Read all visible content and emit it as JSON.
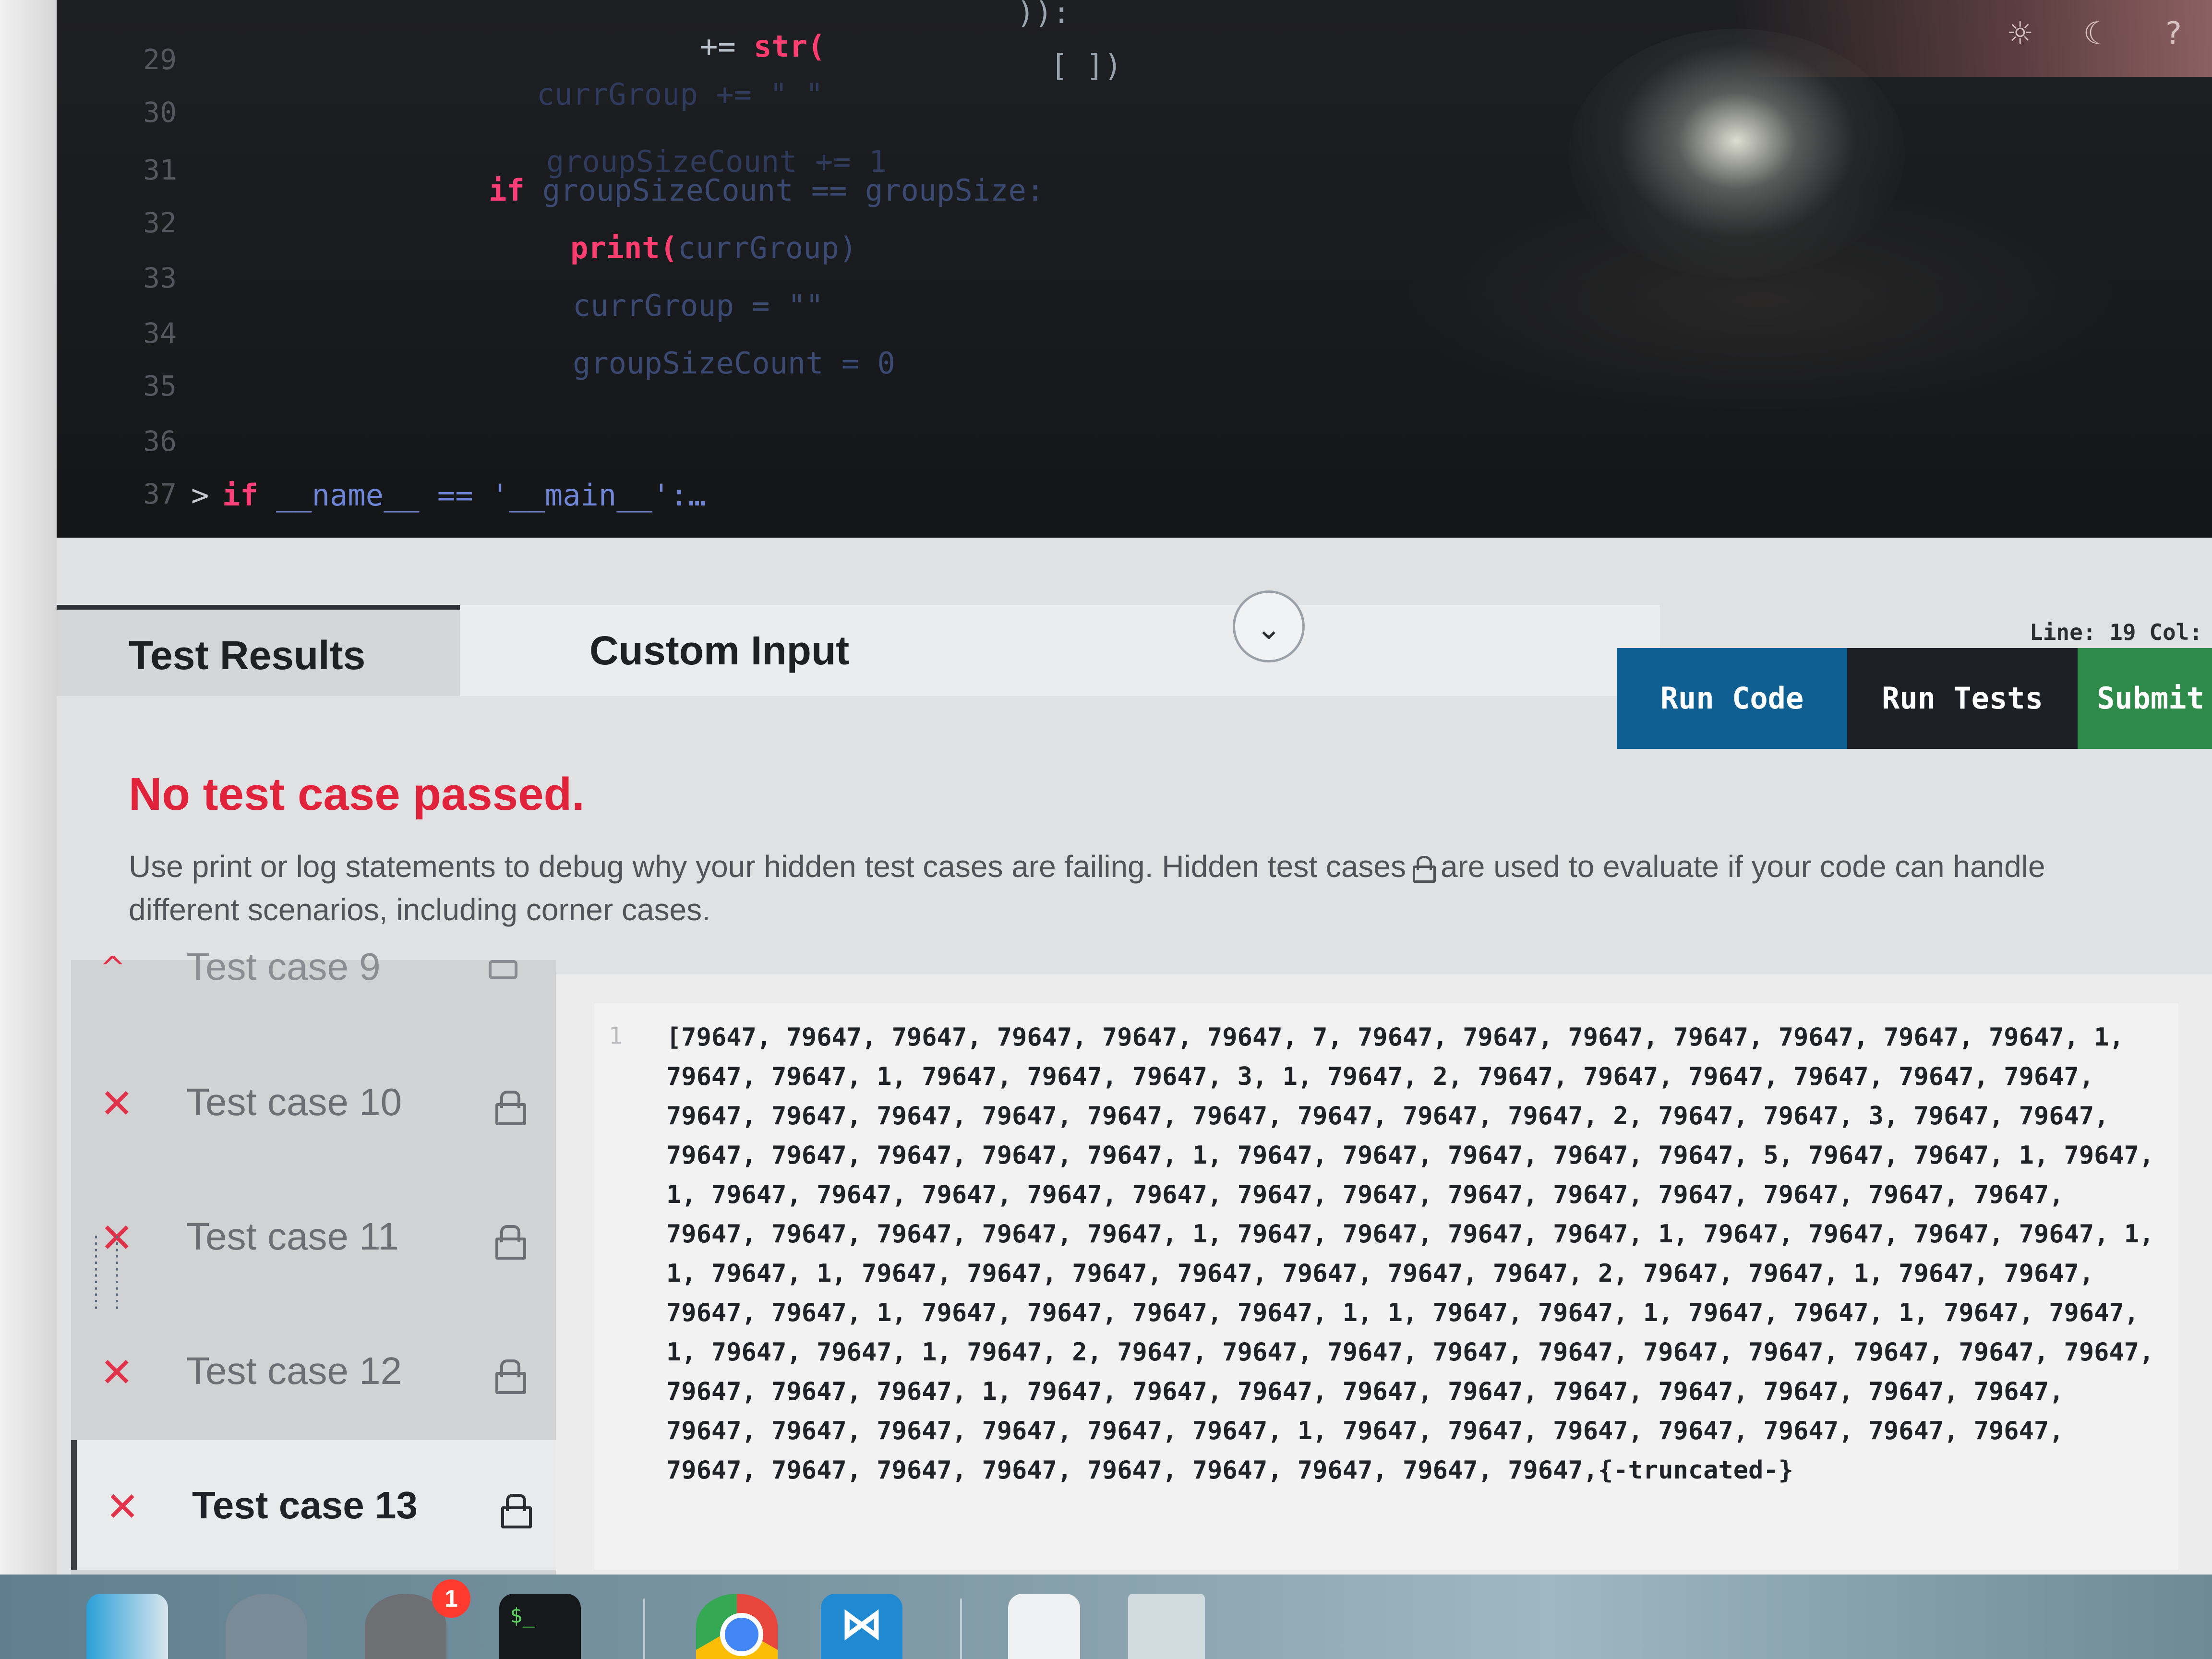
{
  "editor": {
    "lines": [
      {
        "no": "29",
        "code_a": "+= ",
        "code_fn": "str(",
        "code_b": ""
      },
      {
        "no": "30",
        "code_a": "currGroup += \" \"",
        "code_fn": "",
        "code_b": ""
      },
      {
        "no": "31",
        "code_a": "groupSizeCount += 1",
        "code_fn": "",
        "code_b": ""
      },
      {
        "no": "32",
        "kw": "if",
        "code_a": " groupSizeCount == groupSize:",
        "code_fn": "",
        "code_b": ""
      },
      {
        "no": "33",
        "code_fn": "print(",
        "code_a": "currGroup)",
        "code_b": ""
      },
      {
        "no": "34",
        "code_a": "currGroup = \"\"",
        "code_fn": "",
        "code_b": ""
      },
      {
        "no": "35",
        "code_a": "groupSizeCount = 0",
        "code_fn": "",
        "code_b": ""
      },
      {
        "no": "36",
        "code_a": "",
        "code_fn": "",
        "code_b": ""
      },
      {
        "no": "37",
        "kw": "if",
        "code_a": " __name__ == '__main__':…",
        "code_fn": "",
        "code_b": ""
      }
    ],
    "top_fragment_1": ")):",
    "top_fragment_2": "[ ])",
    "fold_marker": ">",
    "icons": [
      "settings-icon",
      "moon-icon",
      "help-icon"
    ]
  },
  "panel": {
    "tabs": [
      {
        "label": "Test Results"
      },
      {
        "label": "Custom Input"
      }
    ],
    "collapse_glyph": "⌄",
    "cursor_position": "Line: 19 Col:",
    "actions": {
      "run_code": "Run Code",
      "run_tests": "Run Tests",
      "submit": "Submit"
    },
    "status": "No test case passed.",
    "help_text_1": "Use print or log statements to debug why your hidden test cases are failing. Hidden test cases",
    "help_text_2": "are used to evaluate if your code can handle different scenarios, including corner cases.",
    "test_cases": [
      {
        "label": "Test case 9",
        "status": "expanded"
      },
      {
        "label": "Test case 10",
        "status": "failed",
        "hidden": true
      },
      {
        "label": "Test case 11",
        "status": "failed",
        "hidden": true
      },
      {
        "label": "Test case 12",
        "status": "failed",
        "hidden": true
      },
      {
        "label": "Test case 13",
        "status": "failed",
        "hidden": true,
        "selected": true
      }
    ],
    "fail_glyph": "✕",
    "expand_glyph": "^",
    "output": {
      "line_no": "1",
      "text": "[79647, 79647, 79647, 79647, 79647, 79647, 7, 79647, 79647, 79647, 79647, 79647, 79647, 79647, 1, 79647, 79647, 1, 79647, 79647, 79647, 3, 1, 79647, 2, 79647, 79647, 79647, 79647, 79647, 79647, 79647, 79647, 79647, 79647, 79647, 79647, 79647, 79647, 79647, 2, 79647, 79647, 3, 79647, 79647, 79647, 79647, 79647, 79647, 79647, 1, 79647, 79647, 79647, 79647, 79647, 5, 79647, 79647, 1, 79647, 1, 79647, 79647, 79647, 79647, 79647, 79647, 79647, 79647, 79647, 79647, 79647, 79647, 79647, 79647, 79647, 79647, 79647, 79647, 1, 79647, 79647, 79647, 79647, 1, 79647, 79647, 79647, 79647, 1, 1, 79647, 1, 79647, 79647, 79647, 79647, 79647, 79647, 79647, 2, 79647, 79647, 1, 79647, 79647, 79647, 79647, 1, 79647, 79647, 79647, 79647, 1, 1, 79647, 79647, 1, 79647, 79647, 1, 79647, 79647, 1, 79647, 79647, 1, 79647, 2, 79647, 79647, 79647, 79647, 79647, 79647, 79647, 79647, 79647, 79647, 79647, 79647, 79647, 1, 79647, 79647, 79647, 79647, 79647, 79647, 79647, 79647, 79647, 79647, 79647, 79647, 79647, 79647, 79647, 79647, 1, 79647, 79647, 79647, 79647, 79647, 79647, 79647, 79647, 79647, 79647, 79647, 79647, 79647, 79647, 79647, 79647,{-truncated-}"
    }
  },
  "dock": {
    "settings_badge": "1",
    "terminal_label": "$_",
    "vscode_glyph": "⋈"
  },
  "colors": {
    "accent_run": "#0f5f93",
    "submit": "#2e8b4a",
    "error": "#e0223a",
    "keyword": "#ff3d77"
  }
}
